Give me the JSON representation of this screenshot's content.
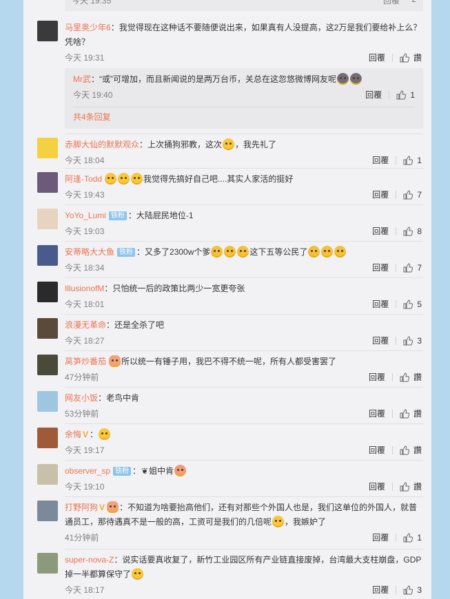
{
  "top_partial": {
    "time": "今天 19:35",
    "reply": "回覆",
    "count": "2"
  },
  "comments": [
    {
      "user": "马里奥少年6",
      "badge": "",
      "text": "：我觉得现在这种话不要随便说出来，如果真有人没提高，这2万是我们要给补上么？凭啥？",
      "time": "今天 19:31",
      "reply": "回覆",
      "like": "讚",
      "avatar_color": "#3a3a3a",
      "sub": {
        "user": "Mr武",
        "text": "：“或”可增加，而且新闻说的是两万台币，关总在这忽悠微博网友呢",
        "time": "今天 19:40",
        "reply": "回覆",
        "like": "1",
        "more": "共4条回复"
      }
    },
    {
      "user": "赤脚大仙的默默观众",
      "badge": "",
      "text_a": "：上次捅狗邪教，这次",
      "text_b": "，我先礼了",
      "time": "今天 18:04",
      "reply": "回覆",
      "like": "1",
      "avatar_color": "#f5d042"
    },
    {
      "user": "阿逢-Todd",
      "badge": "",
      "text": "我觉得先搞好自己吧....其实人家活的挺好",
      "time": "今天 19:43",
      "reply": "回覆",
      "like": "7",
      "avatar_color": "#6b5a7a"
    },
    {
      "user": "YoYo_Lumi",
      "badge": "铁粉",
      "text": "：大陆屁民地位-1",
      "time": "今天 19:03",
      "reply": "回覆",
      "like": "8",
      "avatar_color": "#e8d2c0"
    },
    {
      "user": "安蒂略大大鱼",
      "badge": "铁粉",
      "text_a": "：又多了2300w个爹",
      "text_b": "这下五等公民了",
      "time": "今天 18:34",
      "reply": "回覆",
      "like": "7",
      "avatar_color": "#4a5a8a"
    },
    {
      "user": "IllusionofM",
      "badge": "",
      "text": "：只怕统一后的政策比两少一宽更夸张",
      "time": "今天 18:01",
      "reply": "回覆",
      "like": "5",
      "avatar_color": "#2a2a2a"
    },
    {
      "user": "浪漫无革命",
      "badge": "",
      "text": "：还是全杀了吧",
      "time": "今天 18:27",
      "reply": "回覆",
      "like": "3",
      "avatar_color": "#5a4a3a"
    },
    {
      "user": "莴笋炒番茄",
      "badge": "",
      "text": "所以统一有锤子用，我巴不得不统一呢，所有人都受害罢了",
      "time": "47分钟前",
      "reply": "回覆",
      "like": "讚",
      "avatar_color": "#4a4a3a"
    },
    {
      "user": "网友小饭",
      "badge": "",
      "text": "：老鸟中肯",
      "time": "53分钟前",
      "reply": "回覆",
      "like": "讚",
      "avatar_color": "#9ec6e0"
    },
    {
      "user": "余悔",
      "badge": "",
      "text": "：",
      "time": "今天 19:17",
      "reply": "回覆",
      "like": "讚",
      "avatar_color": "#a05a3a"
    },
    {
      "user": "observer_sp",
      "badge": "铁粉",
      "text_a": "：",
      "text_b": "姐中肯",
      "time": "今天 19:10",
      "reply": "回覆",
      "like": "讚",
      "avatar_color": "#c8c0a8"
    },
    {
      "user": "打野阿狗",
      "badge": "",
      "text": "：不知道为啥要抬高他们，还有对那些个外国人也是，我们这单位的外国人，就普通员工，那待遇真不是一般的高，工资可是我们的几倍呢",
      "text_b": "，我嫉妒了",
      "time": "41分钟前",
      "reply": "回覆",
      "like": "1",
      "avatar_color": "#7a8a9a"
    },
    {
      "user": "super-nova-Z",
      "badge": "",
      "text": "：说实话要真收复了，新竹工业园区所有产业链直接废掉，台湾最大支柱崩盘，GDP掉一半都算保守了",
      "time": "今天 18:17",
      "reply": "回覆",
      "like": "3",
      "avatar_color": "#8a9a7a"
    }
  ]
}
